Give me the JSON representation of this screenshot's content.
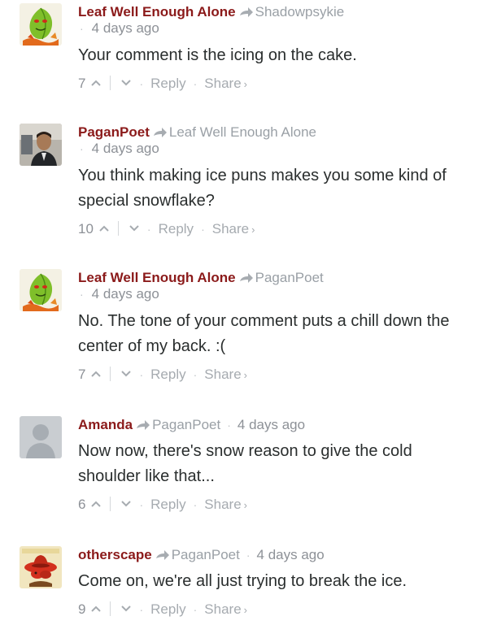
{
  "comments": [
    {
      "author": "Leaf Well Enough Alone",
      "parent": "Shadowpsykie",
      "time": "4 days ago",
      "avatar_icon": "green-leaf-character-avatar",
      "text": "Your comment is the icing on the cake.",
      "votes": "7",
      "reply_label": "Reply",
      "share_label": "Share"
    },
    {
      "author": "PaganPoet",
      "parent": "Leaf Well Enough Alone",
      "time": "4 days ago",
      "avatar_icon": "person-photo-avatar",
      "text": "You think making ice puns makes you some kind of special snowflake?",
      "votes": "10",
      "reply_label": "Reply",
      "share_label": "Share"
    },
    {
      "author": "Leaf Well Enough Alone",
      "parent": "PaganPoet",
      "time": "4 days ago",
      "avatar_icon": "green-leaf-character-avatar",
      "text": "No. The tone of your comment puts a chill down the center of my back. :(",
      "votes": "7",
      "reply_label": "Reply",
      "share_label": "Share"
    },
    {
      "author": "Amanda",
      "parent": "PaganPoet",
      "time": "4 days ago",
      "avatar_icon": "default-user-avatar",
      "text": "Now now, there's snow reason to give the cold shoulder like that...",
      "votes": "6",
      "reply_label": "Reply",
      "share_label": "Share"
    },
    {
      "author": "otherscape",
      "parent": "PaganPoet",
      "time": "4 days ago",
      "avatar_icon": "comic-sombrero-avatar",
      "text": "Come on, we're all just trying to break the ice.",
      "votes": "9",
      "reply_label": "Reply",
      "share_label": "Share"
    }
  ],
  "colors": {
    "author": "#8b1a1a",
    "muted": "#a0a4a8",
    "text": "#2a2e2e"
  }
}
